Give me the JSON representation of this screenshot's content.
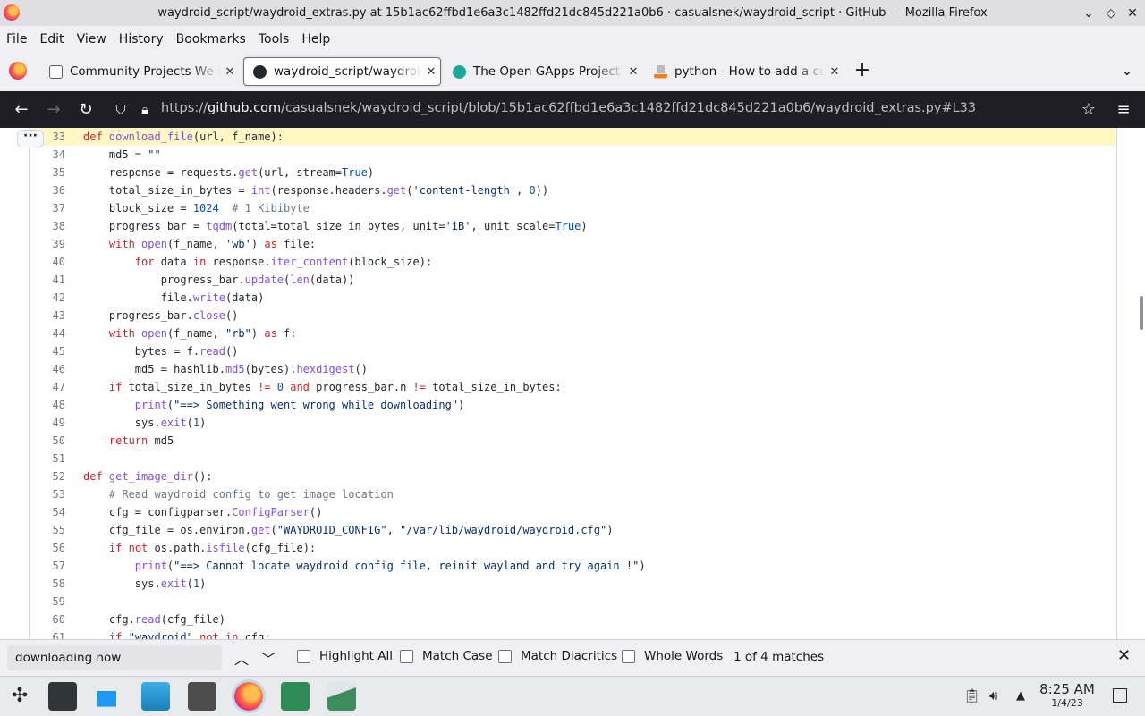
{
  "window": {
    "title": "waydroid_script/waydroid_extras.py at 15b1ac62ffbd1e6a3c1482ffd21dc845d221a0b6 · casualsnek/waydroid_script · GitHub — Mozilla Firefox"
  },
  "menu": [
    "File",
    "Edit",
    "View",
    "History",
    "Bookmarks",
    "Tools",
    "Help"
  ],
  "tabs": [
    {
      "label": "Community Projects We Like",
      "active": false,
      "favicon_color": "#57606a"
    },
    {
      "label": "waydroid_script/waydroid_extras.py",
      "active": true,
      "favicon_color": "#24292f"
    },
    {
      "label": "The Open GApps Project",
      "active": false,
      "favicon_color": "#1ea69a"
    },
    {
      "label": "python - How to add a custom",
      "active": false,
      "favicon_color": "#f48024"
    }
  ],
  "nav": {
    "url_prefix": "https://",
    "url_domain": "github.com",
    "url_path": "/casualsnek/waydroid_script/blob/15b1ac62ffbd1e6a3c1482ffd21dc845d221a0b6/waydroid_extras.py#L33"
  },
  "code_lines": [
    {
      "n": "33",
      "highlight": true,
      "html": "<span class='k'>def</span> <span class='f'>download_file</span>(url, f_name):"
    },
    {
      "n": "34",
      "html": "    md5 = <span class='s'>\"\"</span>"
    },
    {
      "n": "35",
      "html": "    response = requests.<span class='f'>get</span>(url, stream=<span class='n'>True</span>)"
    },
    {
      "n": "36",
      "html": "    total_size_in_bytes = <span class='f'>int</span>(response.headers.<span class='f'>get</span>(<span class='s'>'content-length'</span>, <span class='n'>0</span>))"
    },
    {
      "n": "37",
      "html": "    block_size = <span class='n'>1024</span>  <span class='c'># 1 Kibibyte</span>"
    },
    {
      "n": "38",
      "html": "    progress_bar = <span class='f'>tqdm</span>(total=total_size_in_bytes, unit=<span class='s'>'iB'</span>, unit_scale=<span class='n'>True</span>)"
    },
    {
      "n": "39",
      "html": "    <span class='k'>with</span> <span class='f'>open</span>(f_name, <span class='s'>'wb'</span>) <span class='k'>as</span> file:"
    },
    {
      "n": "40",
      "html": "        <span class='k'>for</span> data <span class='k'>in</span> response.<span class='f'>iter_content</span>(block_size):"
    },
    {
      "n": "41",
      "html": "            progress_bar.<span class='f'>update</span>(<span class='f'>len</span>(data))"
    },
    {
      "n": "42",
      "html": "            file.<span class='f'>write</span>(data)"
    },
    {
      "n": "43",
      "html": "    progress_bar.<span class='f'>close</span>()"
    },
    {
      "n": "44",
      "html": "    <span class='k'>with</span> <span class='f'>open</span>(f_name, <span class='s'>\"rb\"</span>) <span class='k'>as</span> f:"
    },
    {
      "n": "45",
      "html": "        bytes = f.<span class='f'>read</span>()"
    },
    {
      "n": "46",
      "html": "        md5 = hashlib.<span class='f'>md5</span>(bytes).<span class='f'>hexdigest</span>()"
    },
    {
      "n": "47",
      "html": "    <span class='k'>if</span> total_size_in_bytes <span class='k'>!=</span> <span class='n'>0</span> <span class='k'>and</span> progress_bar.n <span class='k'>!=</span> total_size_in_bytes:"
    },
    {
      "n": "48",
      "html": "        <span class='f'>print</span>(<span class='s'>\"==&gt; Something went wrong while downloading\"</span>)"
    },
    {
      "n": "49",
      "html": "        sys.<span class='f'>exit</span>(<span class='n'>1</span>)"
    },
    {
      "n": "50",
      "html": "    <span class='k'>return</span> md5"
    },
    {
      "n": "51",
      "html": ""
    },
    {
      "n": "52",
      "html": "<span class='k'>def</span> <span class='f'>get_image_dir</span>():"
    },
    {
      "n": "53",
      "html": "    <span class='c'># Read waydroid config to get image location</span>"
    },
    {
      "n": "54",
      "html": "    cfg = configparser.<span class='f'>ConfigParser</span>()"
    },
    {
      "n": "55",
      "html": "    cfg_file = os.environ.<span class='f'>get</span>(<span class='s'>\"WAYDROID_CONFIG\"</span>, <span class='s'>\"/var/lib/waydroid/waydroid.cfg\"</span>)"
    },
    {
      "n": "56",
      "html": "    <span class='k'>if</span> <span class='k'>not</span> os.path.<span class='f'>isfile</span>(cfg_file):"
    },
    {
      "n": "57",
      "html": "        <span class='f'>print</span>(<span class='s'>\"==&gt; Cannot locate waydroid config file, reinit wayland and try again !\"</span>)"
    },
    {
      "n": "58",
      "html": "        sys.<span class='f'>exit</span>(<span class='n'>1</span>)"
    },
    {
      "n": "59",
      "html": ""
    },
    {
      "n": "60",
      "html": "    cfg.<span class='f'>read</span>(cfg_file)"
    },
    {
      "n": "61",
      "html": "    <span class='k'>if</span> <span class='s'>\"waydroid\"</span> <span class='k'>not</span> <span class='k'>in</span> cfg:"
    }
  ],
  "findbar": {
    "query": "downloading now",
    "options": [
      "Highlight All",
      "Match Case",
      "Match Diacritics",
      "Whole Words"
    ],
    "matches": "1 of 4 matches"
  },
  "clock": {
    "time": "8:25 AM",
    "date": "1/4/23"
  }
}
